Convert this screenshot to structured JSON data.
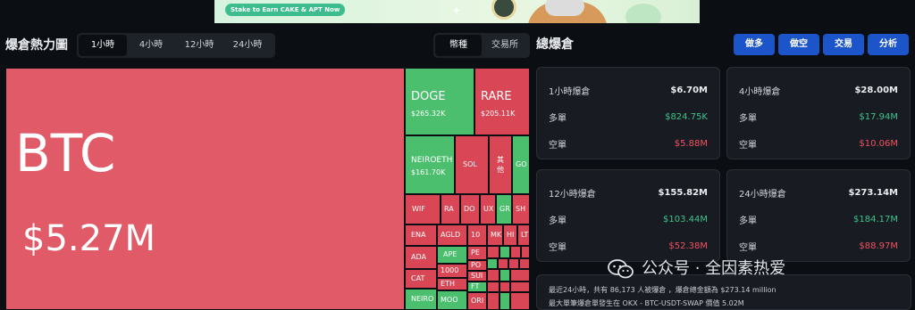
{
  "banner": {
    "text": "Stake to Earn CAKE & APT Now"
  },
  "heatmap": {
    "title": "爆倉熱力圖",
    "time_tabs": [
      "1小時",
      "4小時",
      "12小時",
      "24小時"
    ],
    "type_tabs": [
      "幣種",
      "交易所"
    ],
    "tiles": {
      "btc": {
        "name": "BTC",
        "value": "$5.27M"
      },
      "doge": {
        "name": "DOGE",
        "value": "$265.32K"
      },
      "rare": {
        "name": "RARE",
        "value": "$205.11K"
      },
      "neiro": {
        "name": "NEIROETH",
        "value": "$161.70K"
      },
      "sol": "SOL",
      "other": "其他",
      "go": "GO",
      "wif": "WIF",
      "ra": "RA",
      "do": "DO",
      "ux": "UX",
      "gr": "GR",
      "sh": "SH",
      "ena": "ENA",
      "agld": "AGLD",
      "t10": "10",
      "mk": "MK",
      "hi": "HI",
      "lt": "LT",
      "ada": "ADA",
      "ape": "APE",
      "pe": "PE",
      "cat": "CAT",
      "t1000": "1000",
      "po": "PO",
      "sui": "SUI",
      "neiro2": "NEIRO",
      "eth": "ETH",
      "ft": "FT",
      "moo": "MOO",
      "ori": "ORI"
    }
  },
  "liquidation": {
    "title": "總爆倉",
    "buttons": [
      "做多",
      "做空",
      "交易",
      "分析"
    ],
    "cards": [
      {
        "label": "1小時爆倉",
        "total": "$6.70M",
        "long_label": "多單",
        "long": "$824.75K",
        "short_label": "空單",
        "short": "$5.88M"
      },
      {
        "label": "4小時爆倉",
        "total": "$28.00M",
        "long_label": "多單",
        "long": "$17.94M",
        "short_label": "空單",
        "short": "$10.06M"
      },
      {
        "label": "12小時爆倉",
        "total": "$155.82M",
        "long_label": "多單",
        "long": "$103.44M",
        "short_label": "空單",
        "short": "$52.38M"
      },
      {
        "label": "24小時爆倉",
        "total": "$273.14M",
        "long_label": "多單",
        "long": "$184.17M",
        "short_label": "空單",
        "short": "$88.97M"
      }
    ],
    "summary_line1": "最近24小時，共有 86,173 人被爆倉 ，爆倉總金額為 $273.14 million",
    "summary_line2": "最大單筆爆倉單發生在 OKX - BTC-USDT-SWAP 價值 5.02M"
  },
  "watermark": {
    "text": "公众号 · 全因素热爱"
  },
  "colors": {
    "loss": "#e05a67",
    "gain": "#4cbf6e",
    "button": "#1c54c9",
    "long_text": "#3ec28a",
    "short_text": "#f0505f"
  }
}
